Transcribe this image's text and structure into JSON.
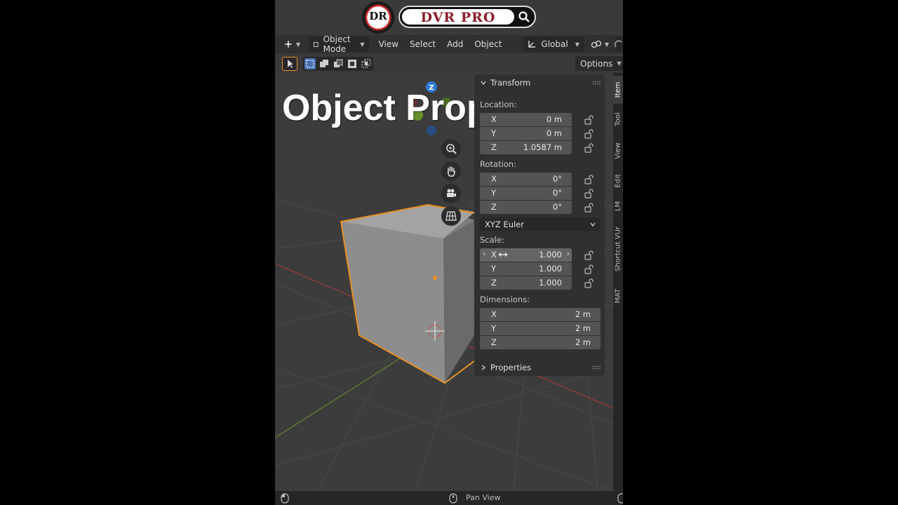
{
  "banner": {
    "logo_initials": "DR",
    "logo_text": "DVR PRO"
  },
  "header": {
    "mode_label": "Object Mode",
    "menus": [
      "View",
      "Select",
      "Add",
      "Object"
    ],
    "orientation_label": "Global"
  },
  "toolbar": {
    "options_label": "Options"
  },
  "overlay": {
    "title": "Object Properties"
  },
  "gizmo": {
    "z_axis_label": "Z"
  },
  "npanel": {
    "transform_label": "Transform",
    "location_label": "Location:",
    "location": [
      {
        "axis": "X",
        "value": "0 m"
      },
      {
        "axis": "Y",
        "value": "0 m"
      },
      {
        "axis": "Z",
        "value": "1.0587 m"
      }
    ],
    "rotation_label": "Rotation:",
    "rotation": [
      {
        "axis": "X",
        "value": "0°"
      },
      {
        "axis": "Y",
        "value": "0°"
      },
      {
        "axis": "Z",
        "value": "0°"
      }
    ],
    "rotation_mode": "XYZ Euler",
    "scale_label": "Scale:",
    "scale": [
      {
        "axis": "X",
        "value": "1.000"
      },
      {
        "axis": "Y",
        "value": "1.000"
      },
      {
        "axis": "Z",
        "value": "1.000"
      }
    ],
    "dimensions_label": "Dimensions:",
    "dimensions": [
      {
        "axis": "X",
        "value": "2 m"
      },
      {
        "axis": "Y",
        "value": "2 m"
      },
      {
        "axis": "Z",
        "value": "2 m"
      }
    ],
    "properties_label": "Properties"
  },
  "side_tabs": [
    "Item",
    "Tool",
    "View",
    "Edit",
    "LM",
    "Shortcut VUr",
    "MAT"
  ],
  "status": {
    "pan_label": "Pan View"
  },
  "colors": {
    "selection": "#e8902a",
    "x_axis": "#b83a3a",
    "y_axis": "#6c9a2a",
    "z_axis": "#2e7bd6"
  }
}
